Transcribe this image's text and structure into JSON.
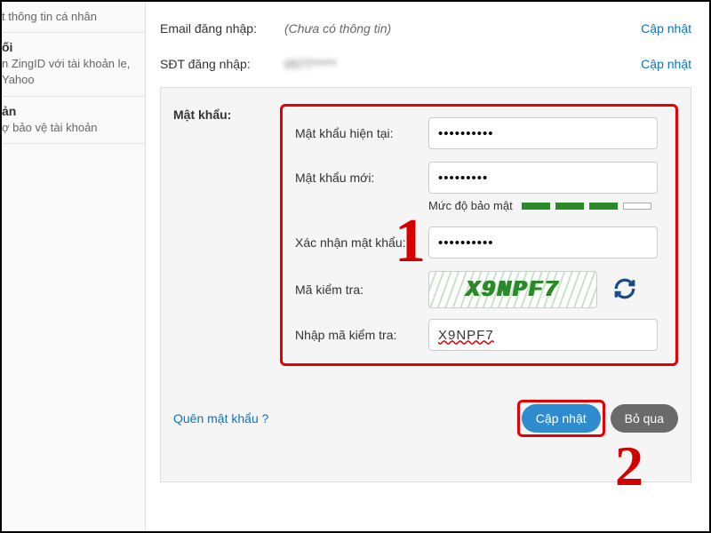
{
  "sidebar": {
    "items": [
      {
        "title": "",
        "desc": "t thông tin cá nhân"
      },
      {
        "title": "ối",
        "desc": "n ZingID với tài khoản\nle, Yahoo"
      },
      {
        "title": "ản",
        "desc": "ợ bảo vệ tài khoản"
      }
    ]
  },
  "email_row": {
    "label": "Email đăng nhập:",
    "value": "(Chưa có thông tin)",
    "action": "Cập nhật"
  },
  "phone_row": {
    "label": "SĐT đăng nhập:",
    "value": "0577*****",
    "action": "Cập nhật"
  },
  "password_panel": {
    "title": "Mật khẩu:",
    "current_label": "Mật khẩu hiện tại:",
    "current_value": "••••••••••",
    "new_label": "Mật khẩu mới:",
    "new_value": "•••••••••",
    "strength_label": "Mức độ bảo mật",
    "confirm_label": "Xác nhận mật khẩu:",
    "confirm_value": "••••••••••",
    "captcha_label": "Mã kiểm tra:",
    "captcha_text": "X9NPF7",
    "captcha_input_label": "Nhập mã kiểm tra:",
    "captcha_input_value": "X9NPF7"
  },
  "actions": {
    "forgot": "Quên mật khẩu ?",
    "submit": "Cập nhật",
    "skip": "Bỏ qua"
  },
  "annotations": {
    "one": "1",
    "two": "2"
  }
}
